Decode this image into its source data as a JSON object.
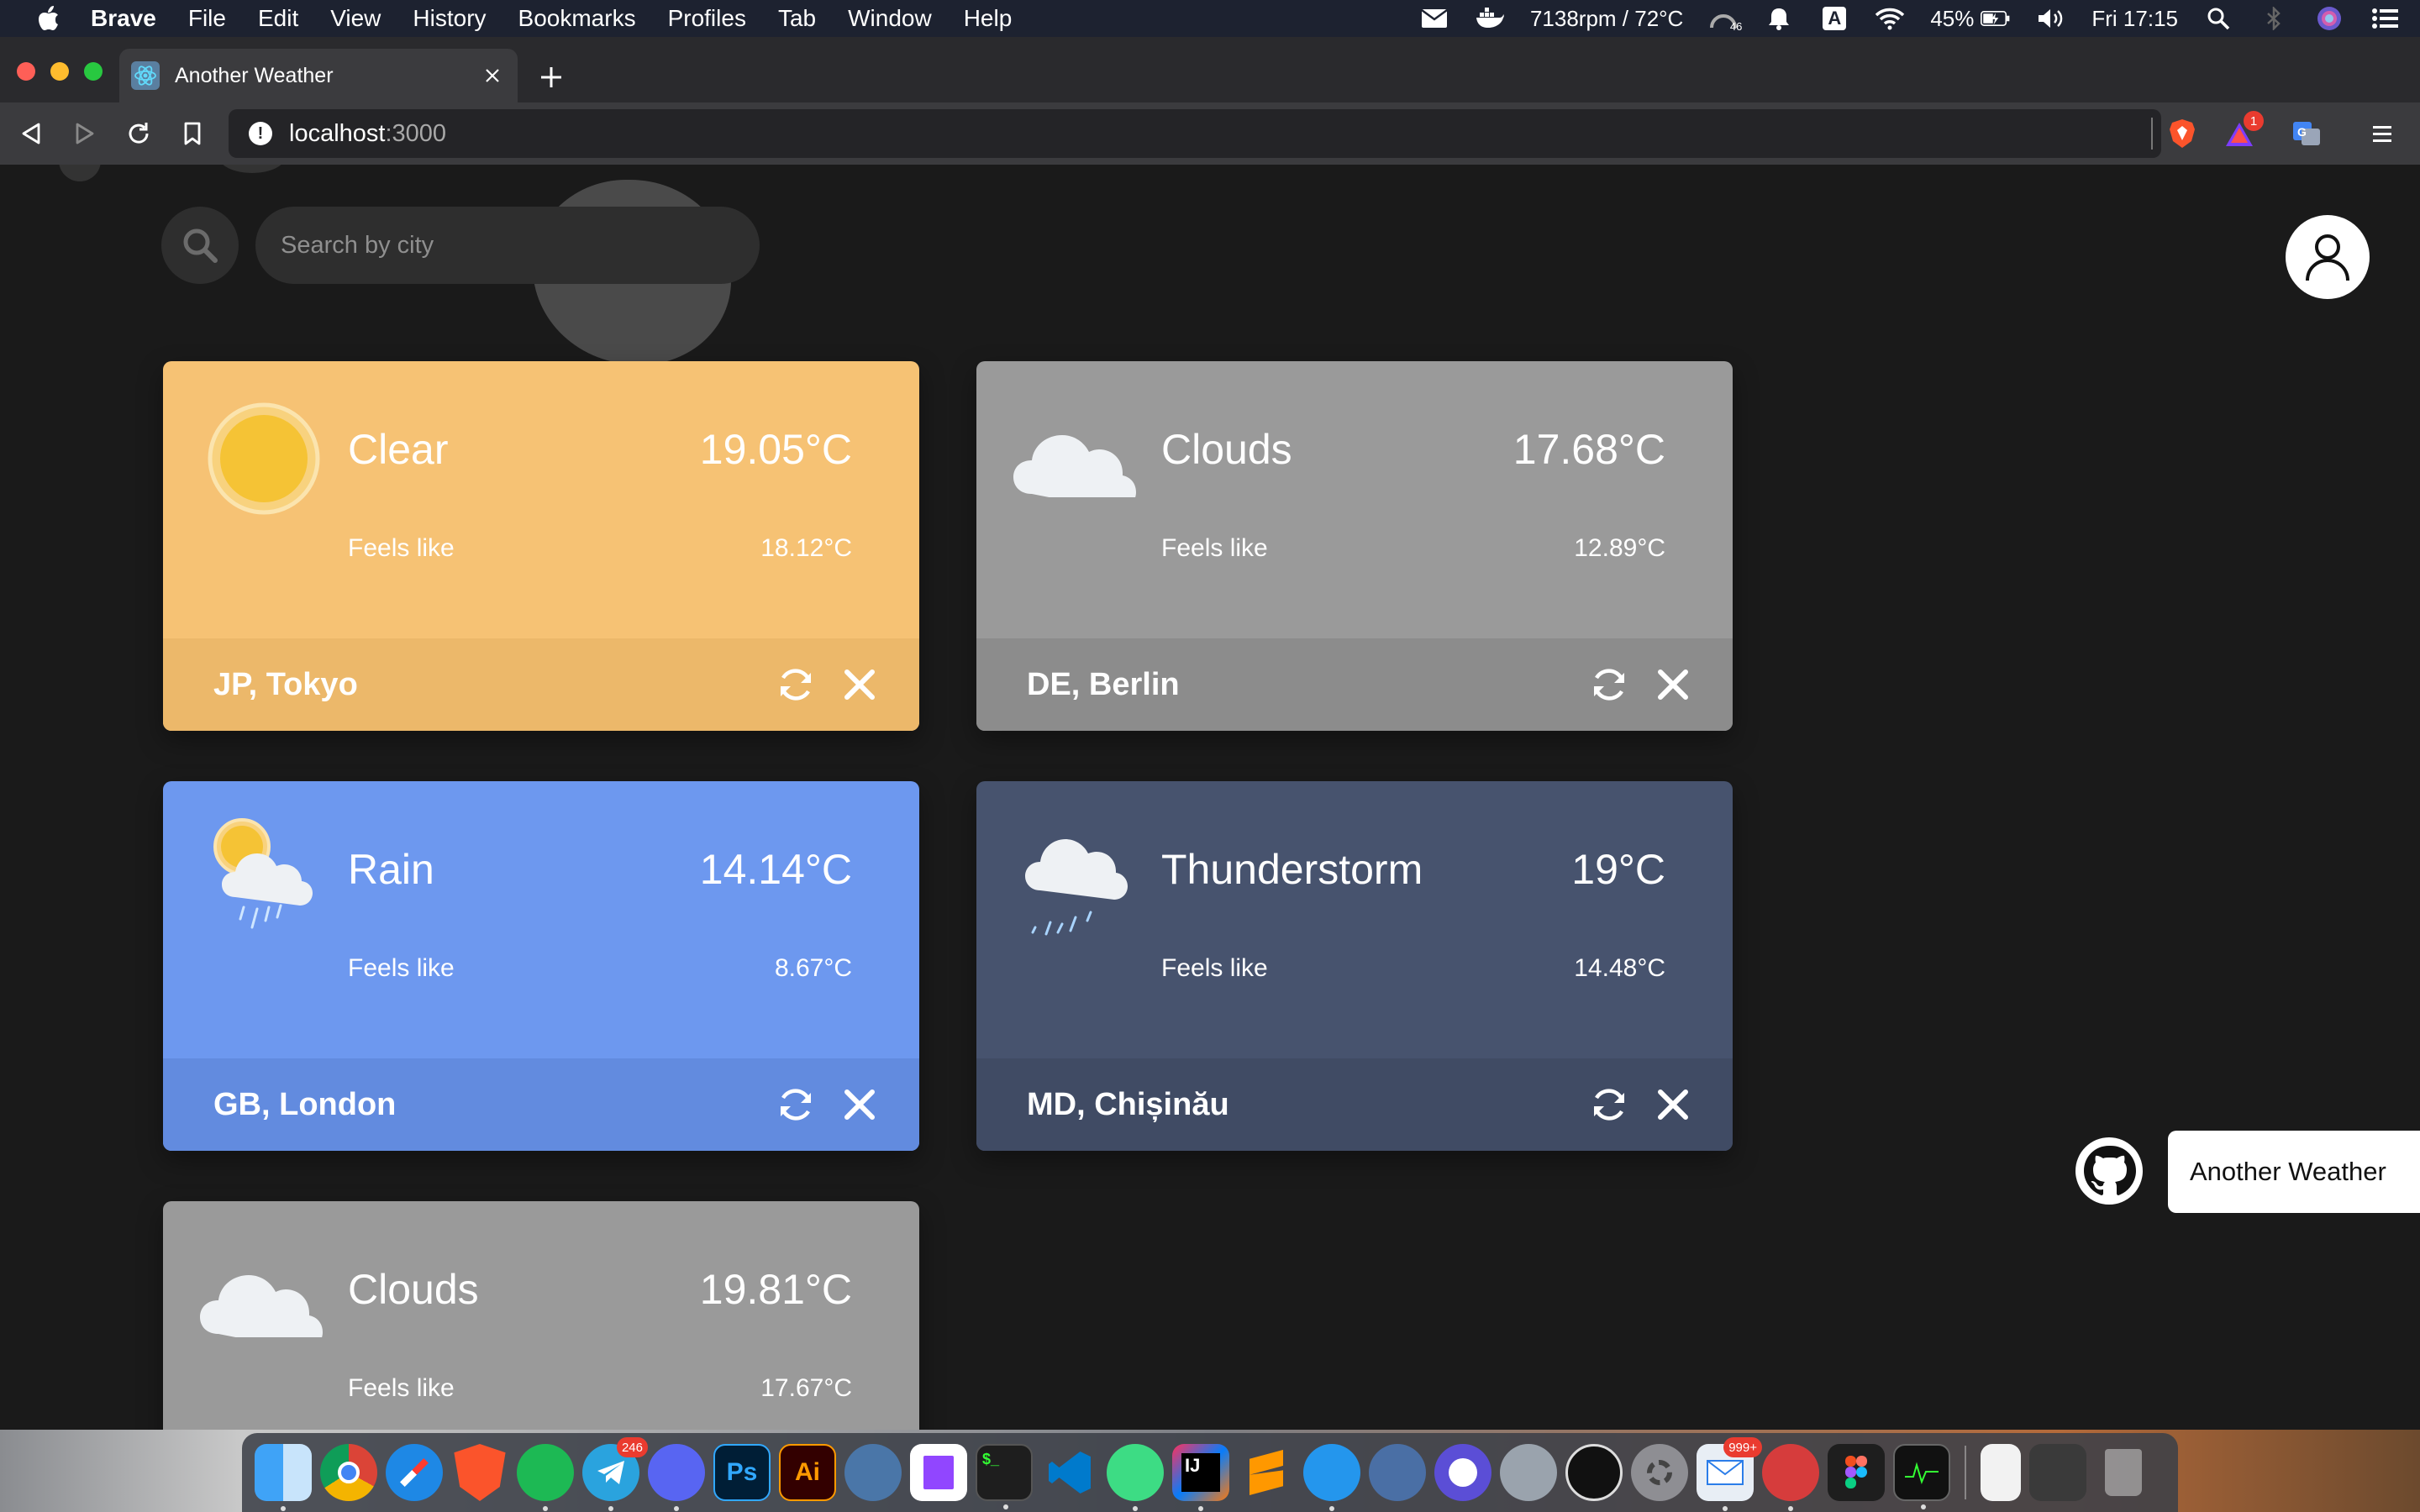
{
  "menubar": {
    "app_name": "Brave",
    "menus": [
      "File",
      "Edit",
      "View",
      "History",
      "Bookmarks",
      "Profiles",
      "Tab",
      "Window",
      "Help"
    ],
    "fan_temp": "7138rpm / 72°C",
    "cpu_badge": "46",
    "input_source": "A",
    "battery": "45%",
    "clock": "Fri 17:15"
  },
  "browser": {
    "tab_title": "Another Weather",
    "url_host": "localhost",
    "url_port": ":3000",
    "alert_count": "1"
  },
  "page": {
    "search_placeholder": "Search by city",
    "brand_badge": "Another Weather",
    "cards": [
      {
        "icon": "sun-icon",
        "condition": "Clear",
        "temp": "19.05°C",
        "feels_label": "Feels like",
        "feels": "18.12°C",
        "city": "JP, Tokyo",
        "bg": "#f6c274",
        "footer_bg": "#ecb86a"
      },
      {
        "icon": "cloud-icon",
        "condition": "Clouds",
        "temp": "17.68°C",
        "feels_label": "Feels like",
        "feels": "12.89°C",
        "city": "DE, Berlin",
        "bg": "#9a9a9a",
        "footer_bg": "#8c8c8c"
      },
      {
        "icon": "sun-cloud-rain-icon",
        "condition": "Rain",
        "temp": "14.14°C",
        "feels_label": "Feels like",
        "feels": "8.67°C",
        "city": "GB, London",
        "bg": "#6d98ef",
        "footer_bg": "#628bdf"
      },
      {
        "icon": "cloud-rain-icon",
        "condition": "Thunderstorm",
        "temp": "19°C",
        "feels_label": "Feels like",
        "feels": "14.48°C",
        "city": "MD, Chișinău",
        "bg": "#47536e",
        "footer_bg": "#404b64"
      },
      {
        "icon": "cloud-icon",
        "condition": "Clouds",
        "temp": "19.81°C",
        "feels_label": "Feels like",
        "feels": "17.67°C",
        "city": "",
        "bg": "#9a9a9a",
        "footer_bg": "#8c8c8c"
      }
    ]
  },
  "dock": {
    "telegram_badge": "246",
    "mail_badge": "999+",
    "items": [
      "finder-icon",
      "chrome-icon",
      "safari-icon",
      "brave-icon",
      "spotify-icon",
      "telegram-icon",
      "discord-icon",
      "photoshop-icon",
      "illustrator-icon",
      "vk-icon",
      "twitch-icon",
      "terminal-icon",
      "vscode-icon",
      "android-studio-icon",
      "intellij-icon",
      "sublime-icon",
      "docker-icon",
      "tableplus-icon",
      "vpn-icon",
      "preview-icon",
      "speedometer-icon",
      "system-preferences-icon",
      "mail-icon",
      "paw-icon",
      "figma-icon",
      "activity-monitor-icon",
      "archive-icon",
      "downloads-icon",
      "trash-icon"
    ],
    "ps_label": "Ps",
    "ai_label": "Ai",
    "ij_label": "IJ"
  },
  "colors": {
    "menubar_bg": "#1d2230",
    "page_bg": "#1a1a1a",
    "clear_card": "#f6c274",
    "clouds_card": "#9a9a9a",
    "rain_card": "#6d98ef",
    "thunder_card": "#47536e"
  }
}
